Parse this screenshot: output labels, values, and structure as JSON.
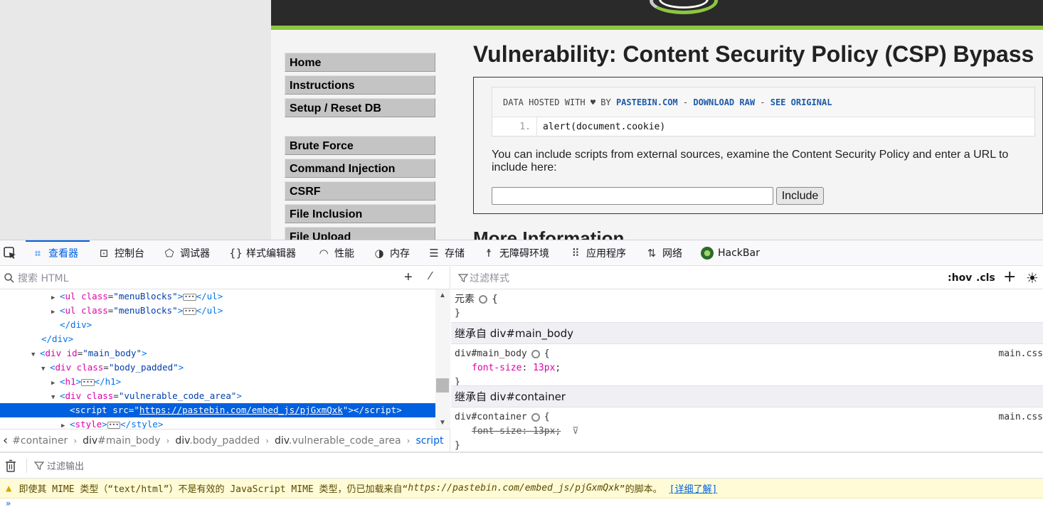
{
  "dvwa": {
    "menu_group1": [
      "Home",
      "Instructions",
      "Setup / Reset DB"
    ],
    "menu_group2": [
      "Brute Force",
      "Command Injection",
      "CSRF",
      "File Inclusion",
      "File Upload"
    ],
    "title": "Vulnerability: Content Security Policy (CSP) Bypass",
    "paste": {
      "head_prefix": "DATA HOSTED WITH ♥ BY ",
      "pastebin_link": "PASTEBIN.COM",
      "sep1": " - ",
      "download_link": "DOWNLOAD RAW",
      "sep2": " - ",
      "original_link": "SEE ORIGINAL",
      "line_number": "1.",
      "line_code": "alert(document.cookie)"
    },
    "help_text": "You can include scripts from external sources, examine the Content Security Policy and enter a URL to include here:",
    "url_input_value": "",
    "include_button": "Include",
    "more_info": "More Information"
  },
  "devtools": {
    "tabs": [
      {
        "label": "查看器",
        "icon": "inspector-icon"
      },
      {
        "label": "控制台",
        "icon": "console-icon"
      },
      {
        "label": "调试器",
        "icon": "debugger-icon"
      },
      {
        "label": "样式编辑器",
        "icon": "style-editor-icon"
      },
      {
        "label": "性能",
        "icon": "performance-icon"
      },
      {
        "label": "内存",
        "icon": "memory-icon"
      },
      {
        "label": "存储",
        "icon": "storage-icon"
      },
      {
        "label": "无障碍环境",
        "icon": "accessibility-icon"
      },
      {
        "label": "应用程序",
        "icon": "application-icon"
      },
      {
        "label": "网络",
        "icon": "network-icon"
      },
      {
        "label": "HackBar",
        "icon": "hackbar-icon"
      }
    ],
    "search_html_placeholder": "搜索 HTML",
    "tree": {
      "l1": {
        "tag": "ul",
        "attr": "class",
        "value": "menuBlocks"
      },
      "l2": {
        "tag": "ul",
        "attr": "class",
        "value": "menuBlocks"
      },
      "l3": "</div>",
      "l4": "</div>",
      "l5": {
        "tag": "div",
        "attr": "id",
        "value": "main_body"
      },
      "l6": {
        "tag": "div",
        "attr": "class",
        "value": "body_padded"
      },
      "l7": {
        "tag": "h1"
      },
      "l8": {
        "tag": "div",
        "attr": "class",
        "value": "vulnerable_code_area"
      },
      "l9": {
        "tag": "script",
        "attr": "src",
        "value": "https://pastebin.com/embed_js/pjGxmQxk"
      },
      "l10": {
        "tag": "style"
      }
    },
    "breadcrumbs": [
      {
        "tag": "",
        "rest": "#container"
      },
      {
        "tag": "div",
        "rest": "#main_body"
      },
      {
        "tag": "div",
        "rest": ".body_padded"
      },
      {
        "tag": "div",
        "rest": ".vulnerable_code_area"
      },
      {
        "tag": "script",
        "rest": ""
      }
    ],
    "rules": {
      "filter_placeholder": "过滤样式",
      "hov": ":hov",
      "cls": ".cls",
      "element_label": "元素",
      "open_brace": "{",
      "close_brace": "}",
      "inherit1": "继承自 div#main_body",
      "rule1_selector": "div#main_body",
      "rule1_prop": "font-size",
      "rule1_value": "13px",
      "rule1_src": "main.css",
      "inherit2": "继承自 div#container",
      "rule2_selector": "div#container",
      "rule2_prop": "font-size",
      "rule2_value": "13px",
      "rule2_src": "main.css"
    },
    "console": {
      "filter_placeholder": "过滤输出",
      "warn_pre": "即使其 MIME 类型（“text/html”）不是有效的 JavaScript MIME 类型，仍已加载来自“",
      "warn_url": "https://pastebin.com/embed_js/pjGxmQxk",
      "warn_post": "”的脚本。",
      "learn_more": "[详细了解]",
      "prompt": "»"
    }
  }
}
